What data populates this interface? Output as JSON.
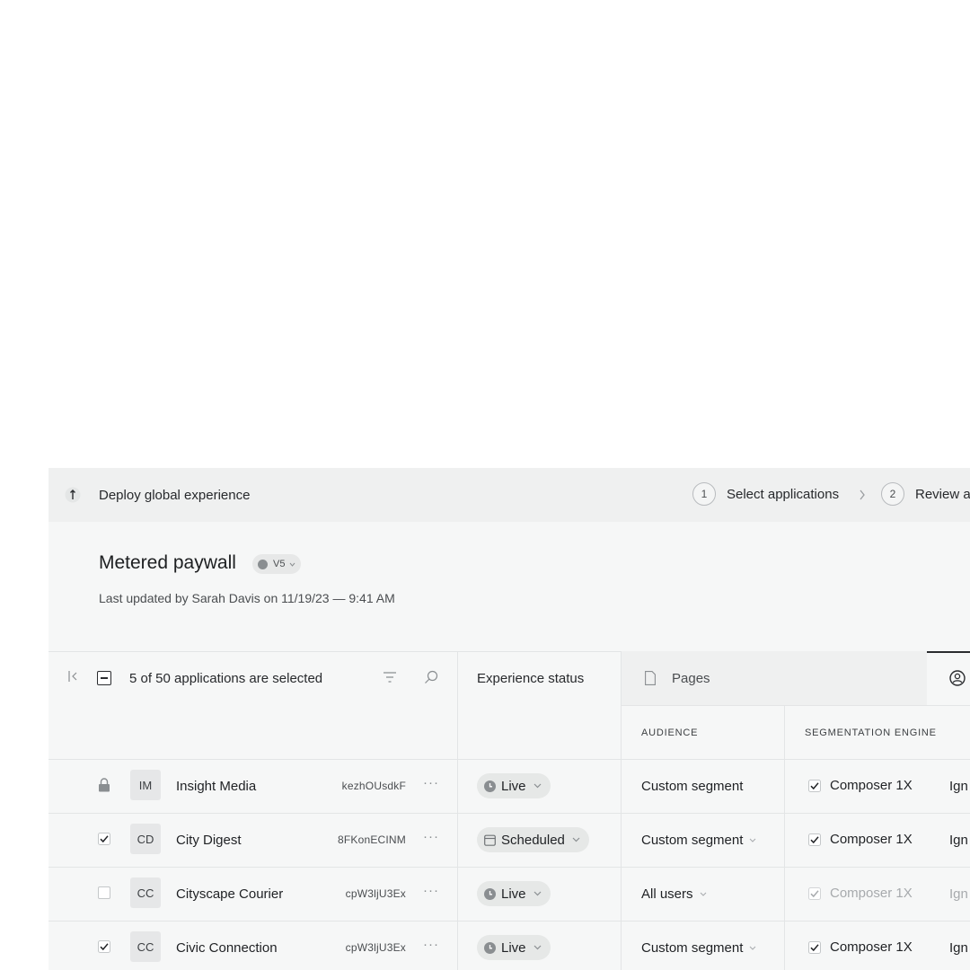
{
  "topbar": {
    "title": "Deploy global experience",
    "steps": [
      {
        "num": "1",
        "label": "Select applications"
      },
      {
        "num": "2",
        "label": "Review a"
      }
    ]
  },
  "experience": {
    "name": "Metered paywall",
    "version": "V5",
    "meta": "Last updated by Sarah Davis on 11/19/23 — 9:41 AM"
  },
  "table": {
    "selection_text": "5 of 50 applications are selected",
    "status_header": "Experience status",
    "pages_tab": "Pages",
    "audience_header": "AUDIENCE",
    "segmentation_header": "SEGMENTATION ENGINE",
    "rows": [
      {
        "initials": "IM",
        "name": "Insight Media",
        "id": "kezhOUsdkF",
        "status": "Live",
        "audience": "Custom segment",
        "engine": "Composer 1X",
        "extra": "Ign",
        "locked": true,
        "checked": false
      },
      {
        "initials": "CD",
        "name": "City Digest",
        "id": "8FKonECINM",
        "status": "Scheduled",
        "audience": "Custom segment",
        "engine": "Composer 1X",
        "extra": "Ign",
        "locked": false,
        "checked": true
      },
      {
        "initials": "CC",
        "name": "Cityscape Courier",
        "id": "cpW3ljU3Ex",
        "status": "Live",
        "audience": "All users",
        "engine": "Composer 1X",
        "extra": "Ign",
        "locked": false,
        "checked": false
      },
      {
        "initials": "CC",
        "name": "Civic Connection",
        "id": "cpW3ljU3Ex",
        "status": "Live",
        "audience": "Custom segment",
        "engine": "Composer 1X",
        "extra": "Ign",
        "locked": false,
        "checked": true
      }
    ]
  },
  "colors": {
    "panel_bg": "#f6f7f7",
    "topbar_bg": "#eff0f0",
    "pill_bg": "#e6e8e7",
    "muted_text": "#a7aaad"
  }
}
